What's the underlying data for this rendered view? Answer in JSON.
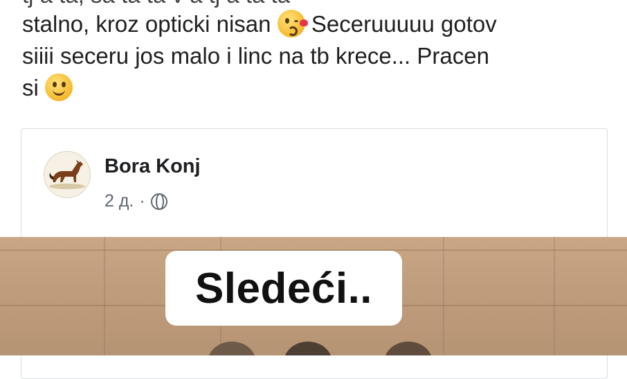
{
  "post": {
    "clipped_top_line": "tj a ta, sa ta ta v a tj a ta ta",
    "line1": "stalno, kroz opticki nisan",
    "line1_cont": "Seceruuuuu gotov",
    "line2": "siiii seceru jos malo i linc na tb krece... Pracen",
    "line3": "si",
    "emoji_1": "kissing-heart-emoji",
    "emoji_2": "smiling-face-emoji"
  },
  "shared_post": {
    "author": "Bora Konj",
    "time": "2 д.",
    "separator": "·",
    "visibility_icon": "globe-icon",
    "avatar_icon": "horse-icon"
  },
  "image": {
    "caption": "Sledeći.."
  }
}
